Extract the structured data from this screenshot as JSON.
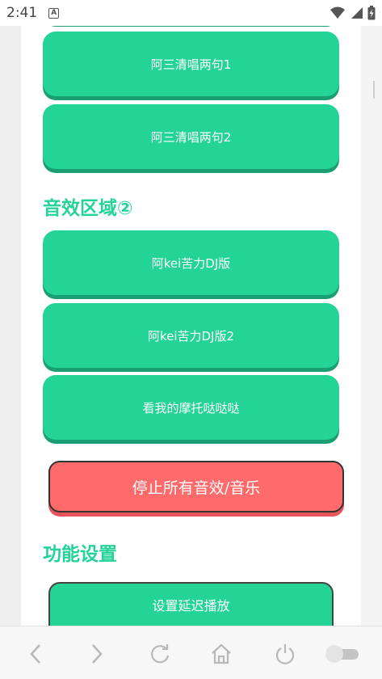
{
  "status_bar": {
    "time": "2:41",
    "notification_icon": "a-box-icon",
    "icons": [
      "wifi-icon",
      "signal-icon",
      "battery-icon"
    ]
  },
  "sound_area_1": {
    "buttons": [
      {
        "label": ""
      },
      {
        "label": "阿三清唱两句1"
      },
      {
        "label": "阿三清唱两句2"
      }
    ]
  },
  "sound_area_2": {
    "title": "音效区域②",
    "buttons": [
      {
        "label": "阿kei苦力DJ版"
      },
      {
        "label": "阿kei苦力DJ版2"
      },
      {
        "label": "看我的摩托哒哒哒"
      }
    ]
  },
  "stop_button": {
    "label": "停止所有音效/音乐"
  },
  "settings": {
    "title": "功能设置",
    "delay_button": {
      "label": "设置延迟播放"
    }
  },
  "nav_bar": {
    "icons": [
      "back-icon",
      "forward-icon",
      "refresh-icon",
      "home-icon",
      "power-icon",
      "toggle-icon"
    ]
  },
  "colors": {
    "accent": "#24d496",
    "accent_shadow": "#1c9e74",
    "stop": "#ff6b6b"
  }
}
